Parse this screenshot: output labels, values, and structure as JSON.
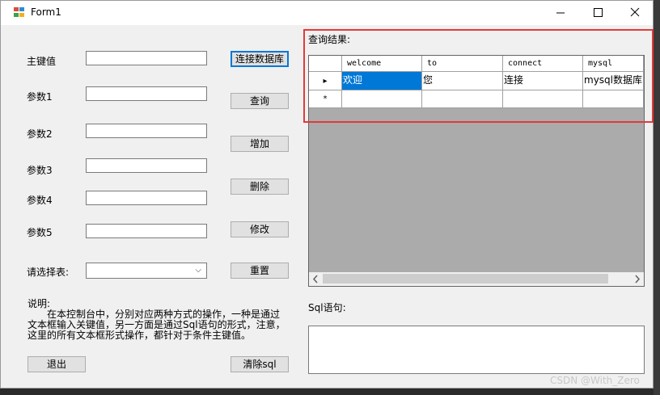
{
  "window": {
    "title": "Form1"
  },
  "labels": {
    "primary_key": "主键值",
    "param1": "参数1",
    "param2": "参数2",
    "param3": "参数3",
    "param4": "参数4",
    "param5": "参数5",
    "select_table": "请选择表:",
    "query_result": "查询结果:",
    "sql_statement": "Sql语句:",
    "description_title": "说明:",
    "description_line1": "在本控制台中，分别对应两种方式的操作，一种是通过",
    "description_line2": "文本框输入关键值，另一方面是通过Sql语句的形式，注意，",
    "description_line3": "这里的所有文本框形式操作，都针对于条件主键值。"
  },
  "inputs": {
    "primary_key": "",
    "param1": "",
    "param2": "",
    "param3": "",
    "param4": "",
    "param5": "",
    "table_select": "",
    "sql_text": ""
  },
  "buttons": {
    "connect": "连接数据库",
    "query": "查询",
    "add": "增加",
    "delete": "删除",
    "modify": "修改",
    "reset": "重置",
    "exit": "退出",
    "clear_sql": "清除sql"
  },
  "grid": {
    "columns": [
      "welcome",
      "to",
      "connect",
      "mysql"
    ],
    "rows": [
      [
        "欢迎",
        "您",
        "连接",
        "mysql数据库"
      ]
    ],
    "new_row_marker": "*",
    "current_row_marker": "▸"
  },
  "watermark": "CSDN @With_Zero",
  "colors": {
    "selection": "#0078d7",
    "highlight_box": "#e23a3a",
    "grid_background": "#ababab"
  }
}
